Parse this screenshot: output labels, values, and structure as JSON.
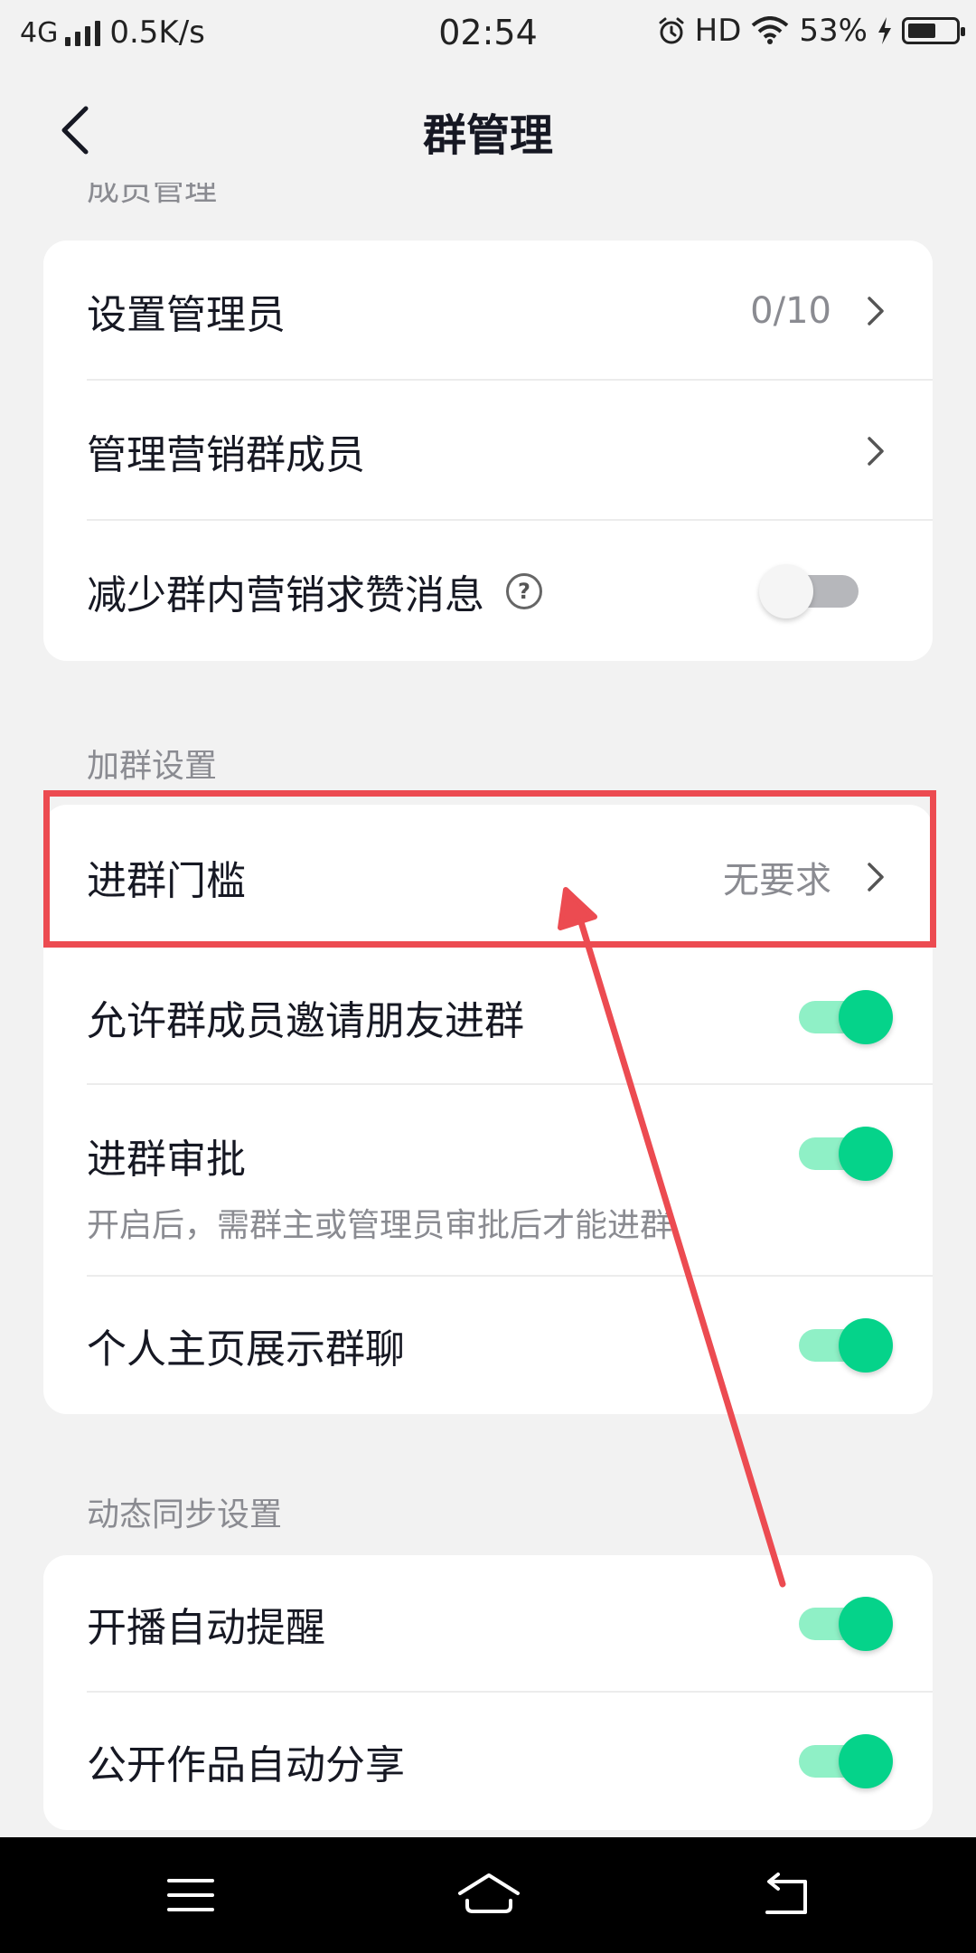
{
  "status_bar": {
    "network": "4G",
    "speed": "0.5K/s",
    "time": "02:54",
    "hd": "HD",
    "battery": "53%"
  },
  "nav": {
    "title": "群管理"
  },
  "sections": {
    "member_manage": {
      "label": "成员管理",
      "rows": {
        "set_admin": {
          "label": "设置管理员",
          "value": "0/10"
        },
        "marketing_members": {
          "label": "管理营销群成员"
        },
        "reduce_marketing": {
          "label": "减少群内营销求赞消息",
          "help": "?",
          "toggle": "off"
        }
      }
    },
    "join_settings": {
      "label": "加群设置",
      "rows": {
        "join_threshold": {
          "label": "进群门槛",
          "value": "无要求"
        },
        "allow_invite": {
          "label": "允许群成员邀请朋友进群",
          "toggle": "on"
        },
        "join_approval": {
          "label": "进群审批",
          "subtitle": "开启后，需群主或管理员审批后才能进群",
          "toggle": "on"
        },
        "show_on_profile": {
          "label": "个人主页展示群聊",
          "toggle": "on"
        }
      }
    },
    "dynamic_sync": {
      "label": "动态同步设置",
      "rows": {
        "live_remind": {
          "label": "开播自动提醒",
          "toggle": "on"
        },
        "auto_share": {
          "label": "公开作品自动分享",
          "toggle": "on"
        }
      }
    }
  },
  "colors": {
    "accent_green": "#05d38a",
    "annotation_red": "#ec4b51",
    "background": "#f2f2f2"
  }
}
